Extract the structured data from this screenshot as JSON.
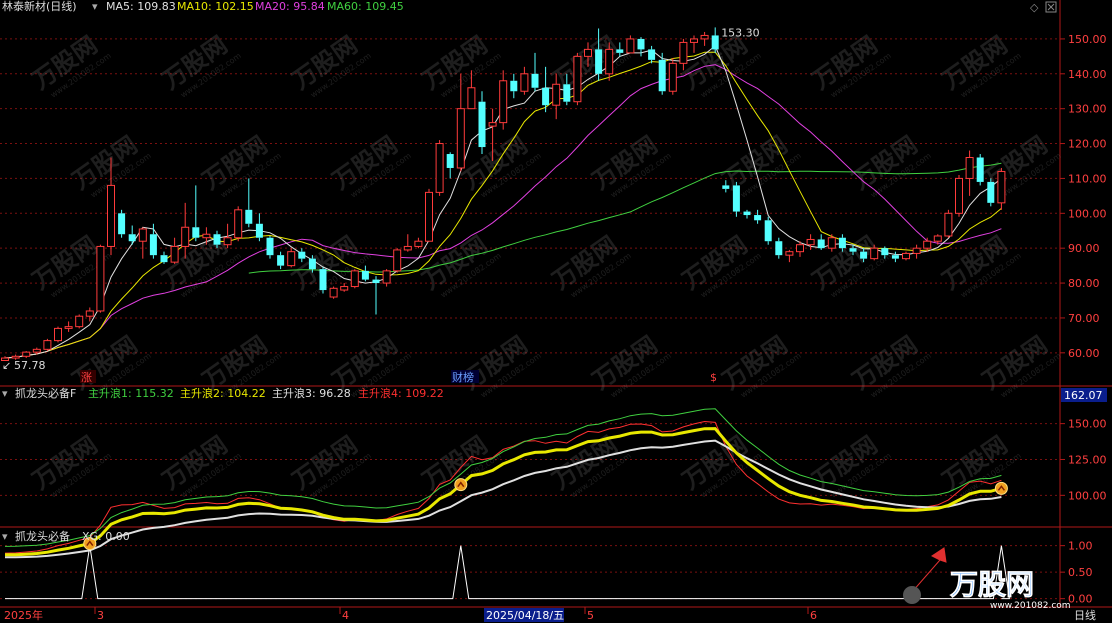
{
  "header": {
    "main_title": "林泰新材(日线)",
    "ma_legend": [
      {
        "label": "MA5: 109.83",
        "color": "#e0e0e0"
      },
      {
        "label": "MA10: 102.15",
        "color": "#e8e800"
      },
      {
        "label": "MA20: 95.84",
        "color": "#e040e0"
      },
      {
        "label": "MA60: 109.45",
        "color": "#40d040"
      }
    ],
    "ind_title": "抓龙头必备F",
    "ind_legend": [
      {
        "label": "主升浪1: 115.32",
        "color": "#40d040"
      },
      {
        "label": "主升浪2: 104.22",
        "color": "#e8e800"
      },
      {
        "label": "主升浪3: 96.28",
        "color": "#e0e0e0"
      },
      {
        "label": "主升浪4: 109.22",
        "color": "#ff3030"
      }
    ],
    "xg_title": "抓龙头必备",
    "xg_legend": "XG: 0.00"
  },
  "colors": {
    "up": "#ff3b3b",
    "down": "#54ffff",
    "grid": "#7a1010",
    "axis_text": "#ff4040"
  },
  "annotations": {
    "max_label": "153.30",
    "min_label": "57.78",
    "zhang": "涨",
    "caibang": "财榜",
    "s_mark": "$",
    "ind_right_value": "162.07"
  },
  "x_axis": {
    "labels": [
      "2025年",
      "3",
      "4",
      "2025/04/18/五",
      "5",
      "6"
    ],
    "right_label": "日线"
  },
  "watermark": {
    "brand": "万股网",
    "url": "www.201082.com"
  },
  "chart_data": [
    {
      "type": "candlestick",
      "title": "林泰新材(日线)",
      "yticks": [
        60,
        70,
        80,
        90,
        100,
        110,
        120,
        130,
        140,
        150
      ],
      "ylim": [
        54.5,
        156
      ],
      "ohlc": [
        [
          57.8,
          59.0,
          57.78,
          58.5
        ],
        [
          58.5,
          59.5,
          58.0,
          59.0
        ],
        [
          59.0,
          60.5,
          58.5,
          60.2
        ],
        [
          60.2,
          61.5,
          59.5,
          61.0
        ],
        [
          61.0,
          64.0,
          60.5,
          63.5
        ],
        [
          63.5,
          67.5,
          63.0,
          67.0
        ],
        [
          67.0,
          69.0,
          66.0,
          67.5
        ],
        [
          67.5,
          71.0,
          67.0,
          70.5
        ],
        [
          70.5,
          73.0,
          69.0,
          72.0
        ],
        [
          72.0,
          91.0,
          71.5,
          90.5
        ],
        [
          90.5,
          116.0,
          88.0,
          108.0
        ],
        [
          100.0,
          101.0,
          93.0,
          94.0
        ],
        [
          94.0,
          96.5,
          91.0,
          92.0
        ],
        [
          92.0,
          96.0,
          87.0,
          95.5
        ],
        [
          94.0,
          97.0,
          87.0,
          88.0
        ],
        [
          88.0,
          89.0,
          85.5,
          86.0
        ],
        [
          86.0,
          93.0,
          85.5,
          90.5
        ],
        [
          90.5,
          103.0,
          87.0,
          96.0
        ],
        [
          96.0,
          108.0,
          92.0,
          93.0
        ],
        [
          93.0,
          96.0,
          91.0,
          94.0
        ],
        [
          94.0,
          95.0,
          90.0,
          91.0
        ],
        [
          91.0,
          97.0,
          90.0,
          93.0
        ],
        [
          93.0,
          102.0,
          92.0,
          101.0
        ],
        [
          101.0,
          110.0,
          96.0,
          97.0
        ],
        [
          97.0,
          100.0,
          92.0,
          93.0
        ],
        [
          93.0,
          93.5,
          87.0,
          88.0
        ],
        [
          88.0,
          89.0,
          84.0,
          85.0
        ],
        [
          85.0,
          90.0,
          84.5,
          89.0
        ],
        [
          89.0,
          90.0,
          86.0,
          87.0
        ],
        [
          87.0,
          88.0,
          83.0,
          84.0
        ],
        [
          84.0,
          84.5,
          77.0,
          78.0
        ],
        [
          76.0,
          79.0,
          75.5,
          78.5
        ],
        [
          78.0,
          80.0,
          77.5,
          79.0
        ],
        [
          79.0,
          84.0,
          78.5,
          83.5
        ],
        [
          83.5,
          85.0,
          80.5,
          81.0
        ],
        [
          81.0,
          82.0,
          71.0,
          80.0
        ],
        [
          80.0,
          84.0,
          79.0,
          83.5
        ],
        [
          83.5,
          90.0,
          83.0,
          89.5
        ],
        [
          89.5,
          94.0,
          89.0,
          90.5
        ],
        [
          90.5,
          93.0,
          90.0,
          92.0
        ],
        [
          92.0,
          107.0,
          92.0,
          106.0
        ],
        [
          106.0,
          121.0,
          105.0,
          120.0
        ],
        [
          117.0,
          117.5,
          110.0,
          113.0
        ],
        [
          113.0,
          140.0,
          112.0,
          130.0
        ],
        [
          130.0,
          141.0,
          130.0,
          136.0
        ],
        [
          132.0,
          135.0,
          117.0,
          119.0
        ],
        [
          125.0,
          130.0,
          115.0,
          126.0
        ],
        [
          126.0,
          141.0,
          124.0,
          138.0
        ],
        [
          138.0,
          140.0,
          133.0,
          135.0
        ],
        [
          135.0,
          142.0,
          134.0,
          140.0
        ],
        [
          140.0,
          146.0,
          135.0,
          136.0
        ],
        [
          136.0,
          142.0,
          129.0,
          131.0
        ],
        [
          131.0,
          140.0,
          127.0,
          137.0
        ],
        [
          137.0,
          140.0,
          131.0,
          132.0
        ],
        [
          132.0,
          146.0,
          131.0,
          145.0
        ],
        [
          145.0,
          149.0,
          142.0,
          147.0
        ],
        [
          147.0,
          153.0,
          138.0,
          140.0
        ],
        [
          140.0,
          149.0,
          138.0,
          147.0
        ],
        [
          147.0,
          149.0,
          145.0,
          146.0
        ],
        [
          146.0,
          151.0,
          146.0,
          150.0
        ],
        [
          150.0,
          150.5,
          145.0,
          147.0
        ],
        [
          147.0,
          148.0,
          143.0,
          144.0
        ],
        [
          144.0,
          146.0,
          134.0,
          135.0
        ],
        [
          135.0,
          144.5,
          134.0,
          143.0
        ],
        [
          143.0,
          150.0,
          141.0,
          149.0
        ],
        [
          149.0,
          151.0,
          146.0,
          150.0
        ],
        [
          150.0,
          152.0,
          148.0,
          151.0
        ],
        [
          151.0,
          153.3,
          146.0,
          147.0
        ],
        [
          108.0,
          109.5,
          106.0,
          107.0
        ],
        [
          108.0,
          109.0,
          99.0,
          100.5
        ],
        [
          100.5,
          101.0,
          98.5,
          99.5
        ],
        [
          99.5,
          101.0,
          97.0,
          98.0
        ],
        [
          98.0,
          99.0,
          91.0,
          92.0
        ],
        [
          92.0,
          93.0,
          87.0,
          88.0
        ],
        [
          88.0,
          89.5,
          86.0,
          89.0
        ],
        [
          89.0,
          92.0,
          87.5,
          91.0
        ],
        [
          91.0,
          94.0,
          89.5,
          92.5
        ],
        [
          92.5,
          94.0,
          89.5,
          90.0
        ],
        [
          90.0,
          94.0,
          89.0,
          93.0
        ],
        [
          93.0,
          94.0,
          89.0,
          90.0
        ],
        [
          90.0,
          91.0,
          88.0,
          89.0
        ],
        [
          89.0,
          90.0,
          86.0,
          87.0
        ],
        [
          87.0,
          91.0,
          86.5,
          90.0
        ],
        [
          90.0,
          90.5,
          87.0,
          88.0
        ],
        [
          88.0,
          89.0,
          86.0,
          87.0
        ],
        [
          87.0,
          89.0,
          86.5,
          88.5
        ],
        [
          88.5,
          91.0,
          87.0,
          90.0
        ],
        [
          90.0,
          93.0,
          89.0,
          92.0
        ],
        [
          92.0,
          94.0,
          91.0,
          93.5
        ],
        [
          93.5,
          101.0,
          93.0,
          100.0
        ],
        [
          100.0,
          111.0,
          99.0,
          110.0
        ],
        [
          110.0,
          118.0,
          105.0,
          116.0
        ],
        [
          116.0,
          117.0,
          108.0,
          109.0
        ],
        [
          109.0,
          110.0,
          102.0,
          103.0
        ],
        [
          103.0,
          113.0,
          101.0,
          112.0
        ]
      ]
    },
    {
      "type": "line",
      "title": "抓龙头必备F",
      "yticks": [
        100,
        125,
        150
      ],
      "ylim": [
        80,
        163
      ]
    },
    {
      "type": "line",
      "title": "抓龙头必备",
      "yticks": [
        0.0,
        0.5,
        1.0
      ],
      "ylim": [
        -0.12,
        1.05
      ],
      "peaks_at_index": [
        8,
        43,
        94
      ]
    }
  ]
}
